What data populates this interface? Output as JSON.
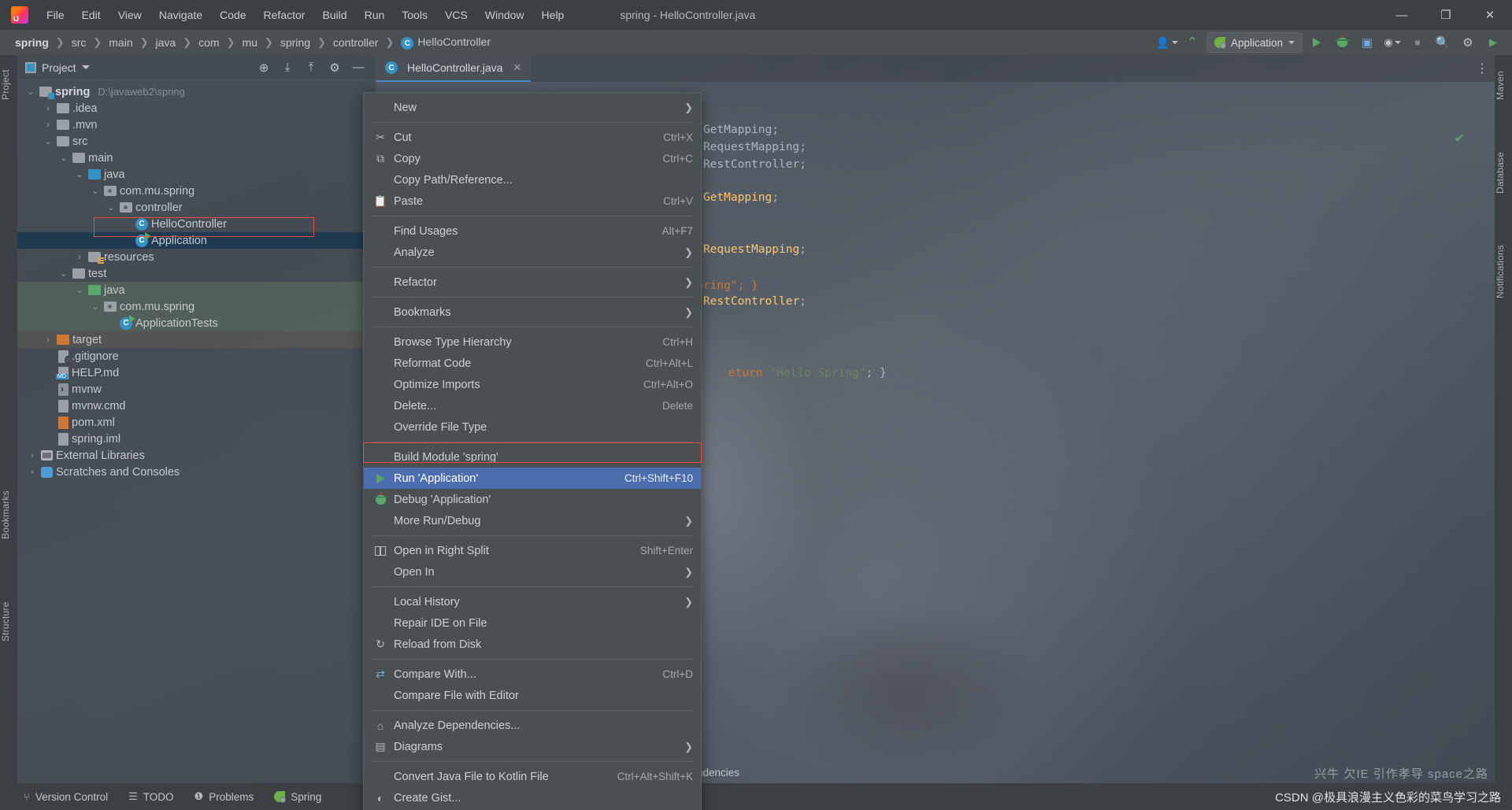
{
  "window": {
    "title": "spring - HelloController.java",
    "minimize_label": "—",
    "maximize_label": "❐",
    "close_label": "✕"
  },
  "menubar": {
    "items": [
      {
        "label": "File"
      },
      {
        "label": "Edit"
      },
      {
        "label": "View"
      },
      {
        "label": "Navigate"
      },
      {
        "label": "Code"
      },
      {
        "label": "Refactor"
      },
      {
        "label": "Build"
      },
      {
        "label": "Run"
      },
      {
        "label": "Tools"
      },
      {
        "label": "VCS"
      },
      {
        "label": "Window"
      },
      {
        "label": "Help"
      }
    ]
  },
  "navbar": {
    "crumbs": [
      "spring",
      "src",
      "main",
      "java",
      "com",
      "mu",
      "spring",
      "controller",
      "HelloController"
    ],
    "crumb_last_icon": "C",
    "separator": "❯",
    "run_config": {
      "label": "Application",
      "icon": "spring-boot-icon",
      "caret": "▾"
    },
    "buttons": [
      {
        "name": "user-presence-icon",
        "glyph": "👥"
      },
      {
        "name": "build-hammer-icon",
        "glyph": "🔨"
      },
      {
        "name": "run-icon",
        "glyph": "▶"
      },
      {
        "name": "debug-icon",
        "glyph": "🐞"
      },
      {
        "name": "run-with-coverage-icon",
        "glyph": "▣"
      },
      {
        "name": "more-run-icon",
        "glyph": "⋯"
      },
      {
        "name": "stop-icon",
        "glyph": "⬛"
      },
      {
        "name": "search-everywhere-icon",
        "glyph": "🔍"
      },
      {
        "name": "settings-gear-icon",
        "glyph": "⚙"
      },
      {
        "name": "updates-icon",
        "glyph": "▶"
      }
    ]
  },
  "project_panel": {
    "title": "Project",
    "header_buttons": [
      {
        "name": "select-opened-file-icon",
        "glyph": "⊕"
      },
      {
        "name": "collapse-all-icon",
        "glyph": "⇥"
      },
      {
        "name": "expand-all-icon",
        "glyph": "⇤"
      },
      {
        "name": "settings-icon",
        "glyph": "⚙"
      },
      {
        "name": "hide-icon",
        "glyph": "—"
      }
    ],
    "tree": [
      {
        "label": "spring",
        "sub": "D:\\javaweb2\\spring",
        "indent": 0,
        "arrow": "v",
        "icon": "module-folder-icon",
        "bold": true
      },
      {
        "label": ".idea",
        "sub": "",
        "indent": 1,
        "arrow": ">",
        "icon": "folder-icon"
      },
      {
        "label": ".mvn",
        "sub": "",
        "indent": 1,
        "arrow": ">",
        "icon": "folder-icon"
      },
      {
        "label": "src",
        "sub": "",
        "indent": 1,
        "arrow": "v",
        "icon": "folder-icon"
      },
      {
        "label": "main",
        "sub": "",
        "indent": 2,
        "arrow": "v",
        "icon": "folder-icon"
      },
      {
        "label": "java",
        "sub": "",
        "indent": 3,
        "arrow": "v",
        "icon": "source-root-icon"
      },
      {
        "label": "com.mu.spring",
        "sub": "",
        "indent": 4,
        "arrow": "v",
        "icon": "package-icon"
      },
      {
        "label": "controller",
        "sub": "",
        "indent": 5,
        "arrow": "v",
        "icon": "package-icon"
      },
      {
        "label": "HelloController",
        "sub": "",
        "indent": 6,
        "arrow": "",
        "icon": "java-class-icon"
      },
      {
        "label": "Application",
        "sub": "",
        "indent": 6,
        "arrow": "",
        "icon": "java-runnable-class-icon",
        "selected": true
      },
      {
        "label": "resources",
        "sub": "",
        "indent": 3,
        "arrow": ">",
        "icon": "resources-root-icon"
      },
      {
        "label": "test",
        "sub": "",
        "indent": 2,
        "arrow": "v",
        "icon": "folder-icon"
      },
      {
        "label": "java",
        "sub": "",
        "indent": 3,
        "arrow": "v",
        "icon": "test-source-root-icon",
        "rowbg": "green"
      },
      {
        "label": "com.mu.spring",
        "sub": "",
        "indent": 4,
        "arrow": "v",
        "icon": "package-icon",
        "rowbg": "green"
      },
      {
        "label": "ApplicationTests",
        "sub": "",
        "indent": 5,
        "arrow": "",
        "icon": "java-test-class-icon",
        "rowbg": "green"
      },
      {
        "label": "target",
        "sub": "",
        "indent": 1,
        "arrow": ">",
        "icon": "excluded-folder-icon",
        "rowbg": "brown"
      },
      {
        "label": ".gitignore",
        "sub": "",
        "indent": 2,
        "arrow": "",
        "icon": "gitignore-file-icon"
      },
      {
        "label": "HELP.md",
        "sub": "",
        "indent": 2,
        "arrow": "",
        "icon": "markdown-file-icon"
      },
      {
        "label": "mvnw",
        "sub": "",
        "indent": 2,
        "arrow": "",
        "icon": "shell-file-icon"
      },
      {
        "label": "mvnw.cmd",
        "sub": "",
        "indent": 2,
        "arrow": "",
        "icon": "cmd-file-icon"
      },
      {
        "label": "pom.xml",
        "sub": "",
        "indent": 2,
        "arrow": "",
        "icon": "maven-pom-icon"
      },
      {
        "label": "spring.iml",
        "sub": "",
        "indent": 2,
        "arrow": "",
        "icon": "iml-file-icon"
      },
      {
        "label": "External Libraries",
        "sub": "",
        "indent": 0,
        "arrow": ">",
        "icon": "libraries-icon"
      },
      {
        "label": "Scratches and Consoles",
        "sub": "",
        "indent": 0,
        "arrow": ">",
        "icon": "scratches-icon"
      }
    ]
  },
  "editor": {
    "tab": {
      "label": "HelloController.java",
      "icon": "java-class-icon",
      "close": "✕"
    },
    "more_tabs_icon": "⋮",
    "code_lines": [
      {
        "text": "ind.annotation.GetMapping;",
        "kind": "import"
      },
      {
        "text": "ind.annotation.RequestMapping;",
        "kind": "import"
      },
      {
        "text": "ind.annotation.RestController;",
        "kind": "import"
      },
      {
        "text": "eturn \"Hello Spring\"; }",
        "kind": "method"
      }
    ],
    "inspection_ok": "✔"
  },
  "context_menu": {
    "items": [
      {
        "label": "New",
        "icon": "",
        "shortcut": "",
        "arrow": "❯",
        "sep_after": true
      },
      {
        "label": "Cut",
        "icon": "scissors-icon",
        "shortcut": "Ctrl+X",
        "underline": "t"
      },
      {
        "label": "Copy",
        "icon": "copy-icon",
        "shortcut": "Ctrl+C",
        "underline": "C"
      },
      {
        "label": "Copy Path/Reference...",
        "icon": "",
        "shortcut": ""
      },
      {
        "label": "Paste",
        "icon": "paste-icon",
        "shortcut": "Ctrl+V",
        "underline": "P",
        "sep_after": true
      },
      {
        "label": "Find Usages",
        "icon": "",
        "shortcut": "Alt+F7"
      },
      {
        "label": "Analyze",
        "icon": "",
        "shortcut": "",
        "arrow": "❯",
        "sep_after": true
      },
      {
        "label": "Refactor",
        "icon": "",
        "shortcut": "",
        "arrow": "❯",
        "sep_after": true
      },
      {
        "label": "Bookmarks",
        "icon": "",
        "shortcut": "",
        "arrow": "❯",
        "sep_after": true
      },
      {
        "label": "Browse Type Hierarchy",
        "icon": "",
        "shortcut": "Ctrl+H"
      },
      {
        "label": "Reformat Code",
        "icon": "",
        "shortcut": "Ctrl+Alt+L"
      },
      {
        "label": "Optimize Imports",
        "icon": "",
        "shortcut": "Ctrl+Alt+O"
      },
      {
        "label": "Delete...",
        "icon": "",
        "shortcut": "Delete"
      },
      {
        "label": "Override File Type",
        "icon": "",
        "shortcut": "",
        "sep_after": true
      },
      {
        "label": "Build Module 'spring'",
        "icon": "",
        "shortcut": ""
      },
      {
        "label": "Run 'Application'",
        "icon": "run-icon",
        "shortcut": "Ctrl+Shift+F10",
        "highlight": true
      },
      {
        "label": "Debug 'Application'",
        "icon": "debug-icon",
        "shortcut": ""
      },
      {
        "label": "More Run/Debug",
        "icon": "",
        "shortcut": "",
        "arrow": "❯",
        "sep_after": true
      },
      {
        "label": "Open in Right Split",
        "icon": "split-icon",
        "shortcut": "Shift+Enter"
      },
      {
        "label": "Open In",
        "icon": "",
        "shortcut": "",
        "arrow": "❯",
        "sep_after": true
      },
      {
        "label": "Local History",
        "icon": "",
        "shortcut": "",
        "arrow": "❯"
      },
      {
        "label": "Repair IDE on File",
        "icon": "",
        "shortcut": ""
      },
      {
        "label": "Reload from Disk",
        "icon": "reload-icon",
        "shortcut": "",
        "sep_after": true
      },
      {
        "label": "Compare With...",
        "icon": "compare-icon",
        "shortcut": "Ctrl+D"
      },
      {
        "label": "Compare File with Editor",
        "icon": "",
        "shortcut": "",
        "sep_after": true
      },
      {
        "label": "Analyze Dependencies...",
        "icon": "analyze-deps-icon",
        "shortcut": ""
      },
      {
        "label": "Diagrams",
        "icon": "diagrams-icon",
        "shortcut": "",
        "arrow": "❯",
        "sep_after": true
      },
      {
        "label": "Convert Java File to Kotlin File",
        "icon": "",
        "shortcut": "Ctrl+Alt+Shift+K"
      },
      {
        "label": "Create Gist...",
        "icon": "gist-icon",
        "shortcut": ""
      }
    ]
  },
  "tool_strips": {
    "left": [
      {
        "label": "Project",
        "name": "tool-window-project"
      },
      {
        "label": "Bookmarks",
        "name": "tool-window-bookmarks"
      },
      {
        "label": "Structure",
        "name": "tool-window-structure"
      }
    ],
    "right": [
      {
        "label": "Maven",
        "name": "tool-window-maven"
      },
      {
        "label": "Database",
        "name": "tool-window-database"
      },
      {
        "label": "Notifications",
        "name": "tool-window-notifications"
      }
    ]
  },
  "statusbar": {
    "items": [
      {
        "label": "Version Control",
        "icon": "branch-icon"
      },
      {
        "label": "TODO",
        "icon": "todo-icon"
      },
      {
        "label": "Problems",
        "icon": "problems-icon"
      },
      {
        "label": "Spring",
        "icon": "spring-icon"
      }
    ],
    "dependency_text": "pendencies",
    "watermark": "CSDN @极具浪漫主义色彩的菜鸟学习之路",
    "ghost_text": "兴牛 欠IE 引作孝导 space之路"
  },
  "colors": {
    "accent": "#4b6eaf",
    "selection": "#1f3b52",
    "highlight_outline": "#e74c3c",
    "run_green": "#59a869",
    "tab_underline": "#4a88c7"
  }
}
